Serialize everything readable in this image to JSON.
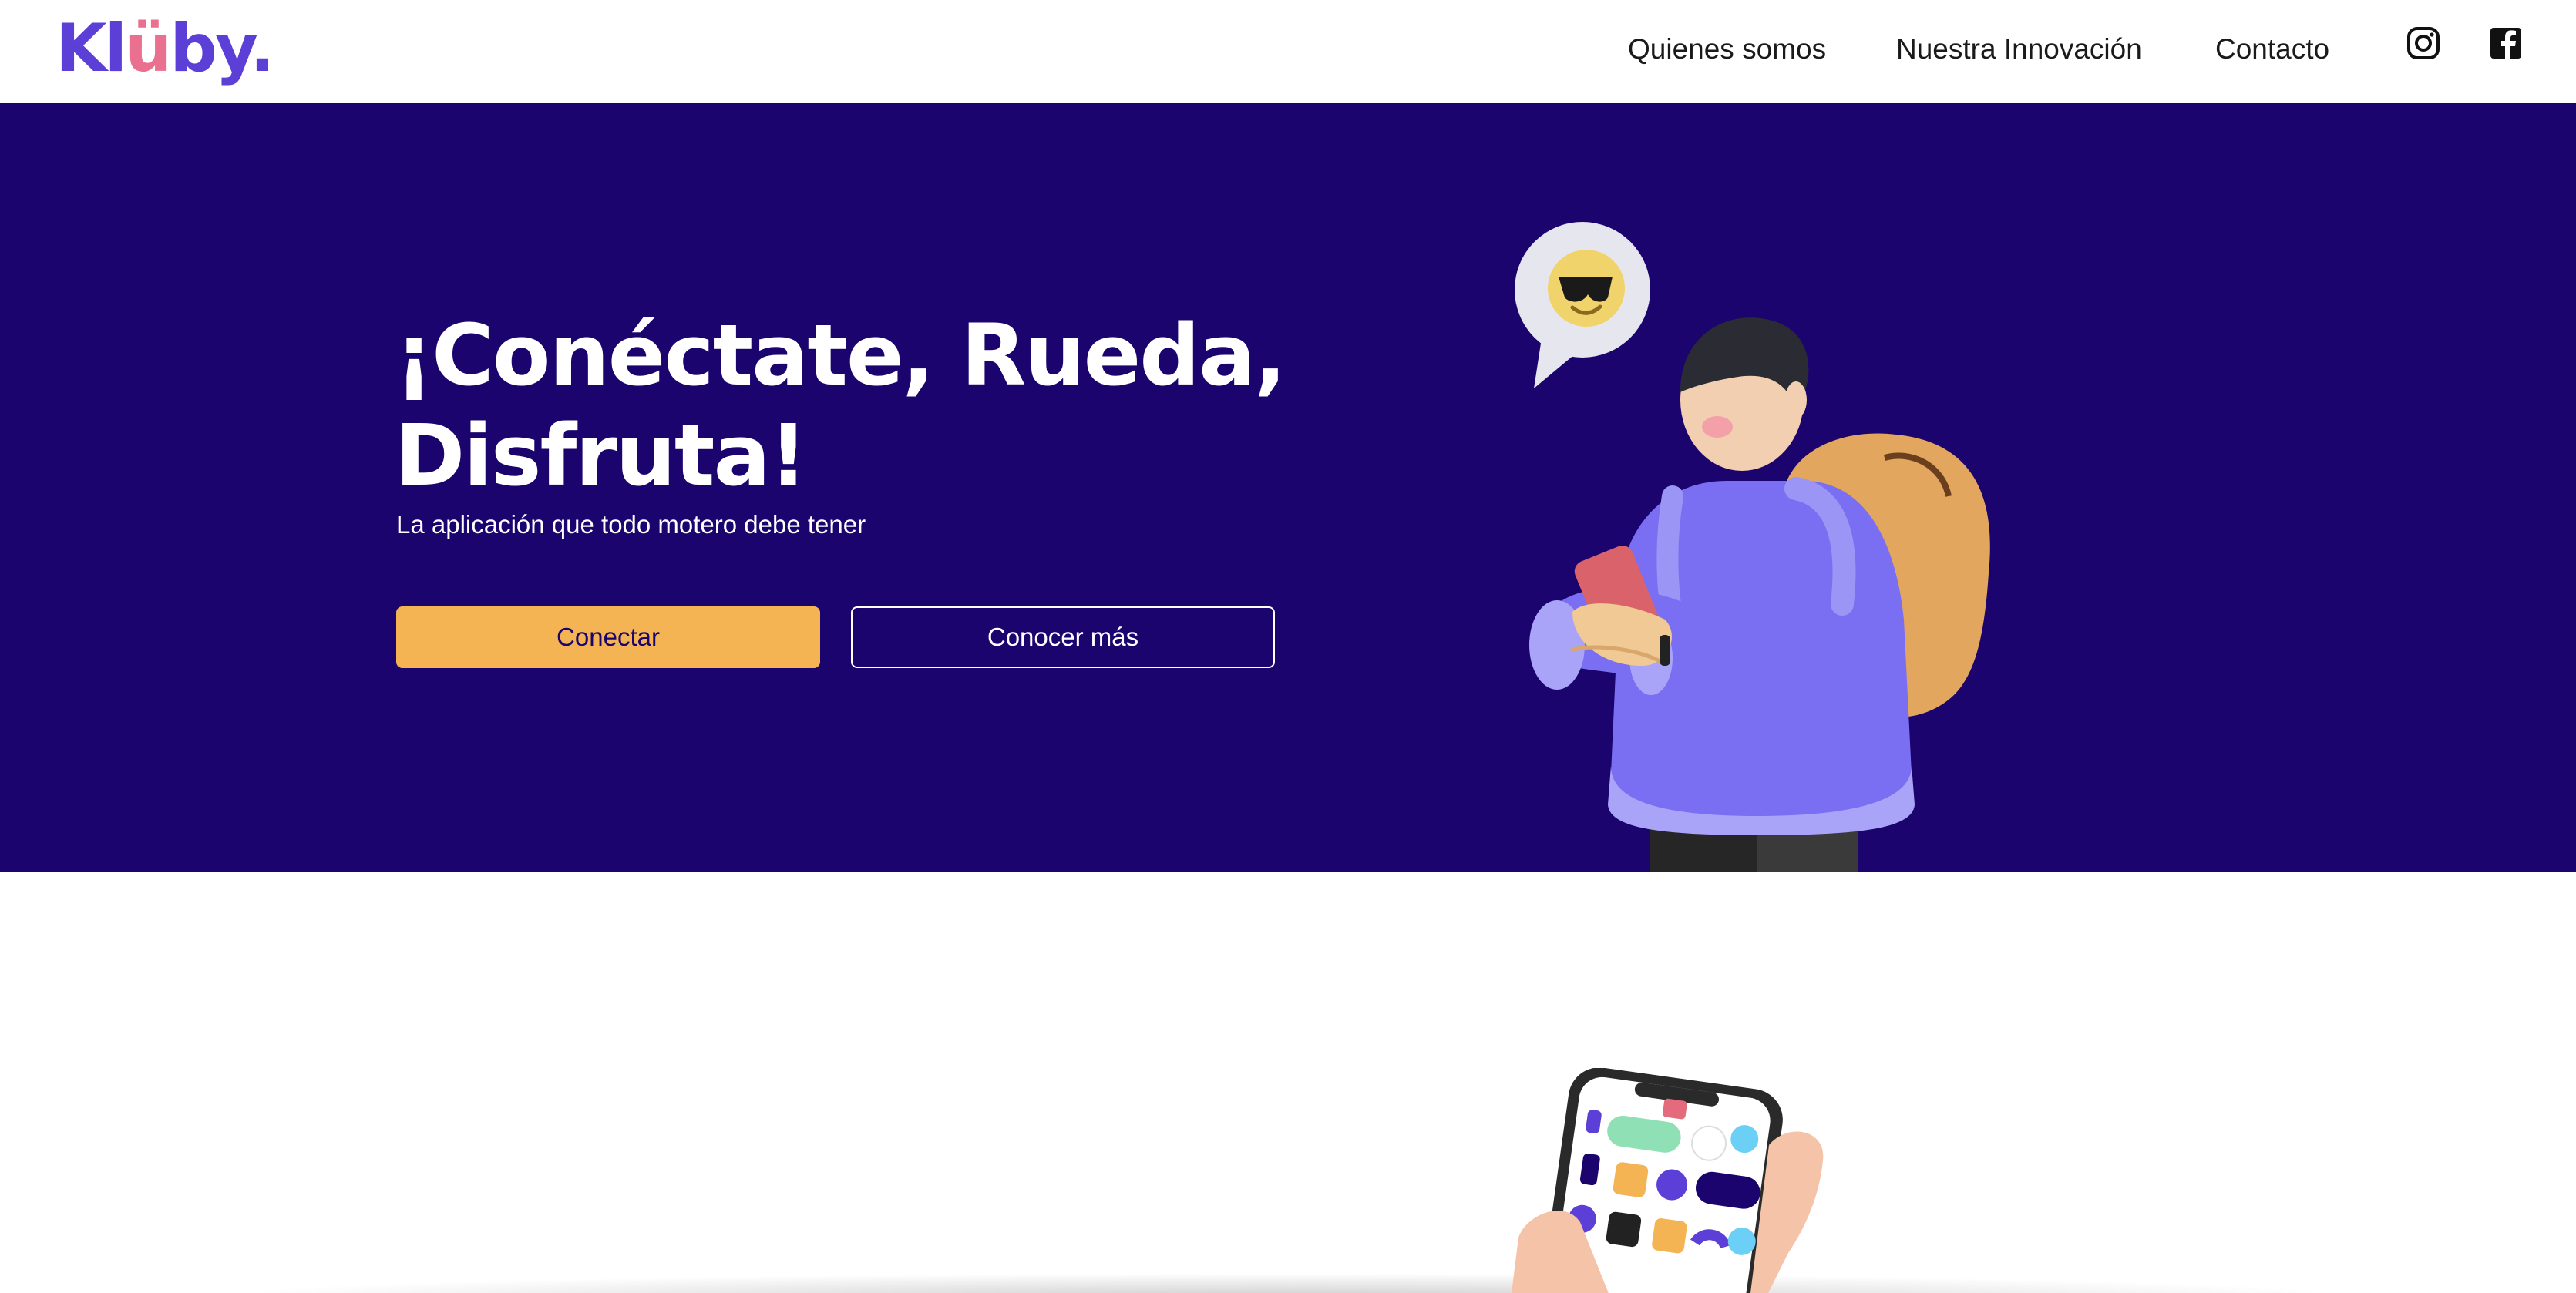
{
  "header": {
    "logo": {
      "part1": "Kl",
      "part2": "ü",
      "part3": "by",
      "part4": "."
    },
    "nav": [
      {
        "label": "Quienes somos"
      },
      {
        "label": "Nuestra Innovación"
      },
      {
        "label": "Contacto"
      }
    ],
    "social_icons": [
      "instagram-icon",
      "facebook-icon"
    ]
  },
  "hero": {
    "title_line1": "¡Conéctate, Rueda,",
    "title_line2": "Disfruta!",
    "subtitle": "La aplicación que todo motero debe tener",
    "primary_button": "Conectar",
    "secondary_button": "Conocer más"
  },
  "colors": {
    "brand_purple": "#5b3fd6",
    "hero_background": "#1b046e",
    "accent_yellow": "#f4b453",
    "logo_pink": "#e9708f"
  }
}
